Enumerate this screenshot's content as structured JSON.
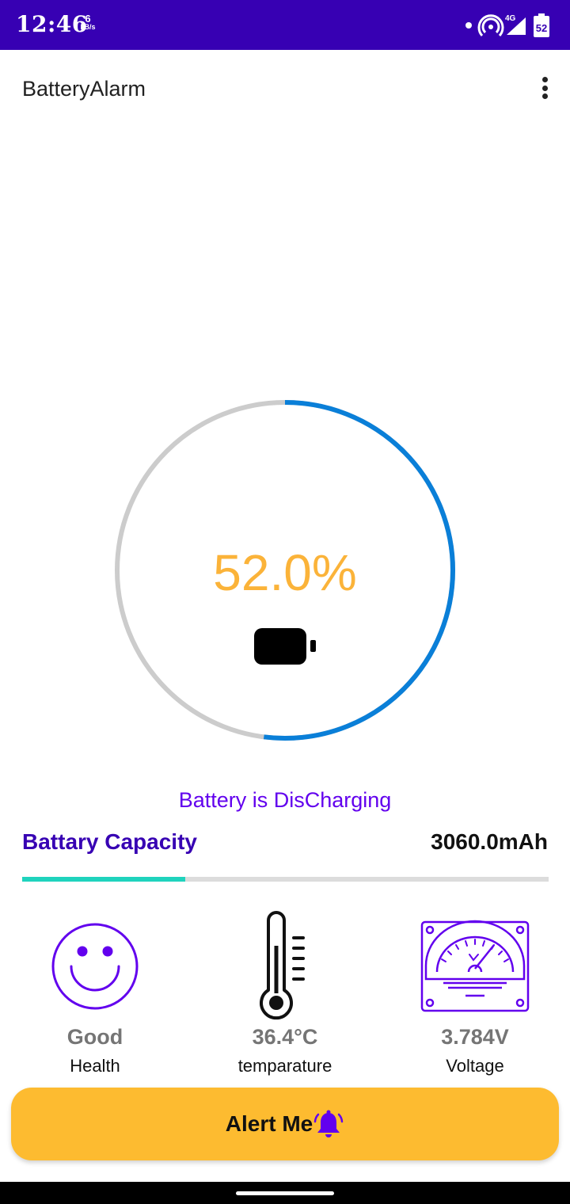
{
  "status_bar": {
    "time": "12:46",
    "net_speed_value": "6",
    "net_speed_unit": "kB/s",
    "network_type": "4G",
    "battery_level": "52",
    "icons": [
      "notification-dot-icon",
      "hotspot-icon",
      "signal-icon",
      "battery-icon"
    ]
  },
  "app_bar": {
    "title": "BatteryAlarm",
    "menu_icon": "more-vert-icon"
  },
  "gauge": {
    "value_text": "52.0%",
    "percent": 52.0,
    "icon": "battery-icon",
    "colors": {
      "progress": "#0a7fd8",
      "track": "#cccccc",
      "value_text": "#fbb339"
    }
  },
  "charge_status": "Battery is DisCharging",
  "capacity": {
    "label": "Battary Capacity",
    "value": "3060.0mAh",
    "bar_fraction": 0.31,
    "colors": {
      "fill": "#1fd3bd",
      "track": "#dcdcdc"
    }
  },
  "stats": [
    {
      "icon": "smiley-face-icon",
      "value": "Good",
      "label": "Health"
    },
    {
      "icon": "thermometer-icon",
      "value": "36.4°C",
      "label": "temparature"
    },
    {
      "icon": "voltmeter-icon",
      "value": "3.784V",
      "label": "Voltage"
    }
  ],
  "alert_button": {
    "label": "Alert Me",
    "icon": "bell-ringing-icon",
    "color": "#fdbb30"
  },
  "accent_colors": {
    "primary": "#3700b3",
    "purple": "#6200ee"
  }
}
